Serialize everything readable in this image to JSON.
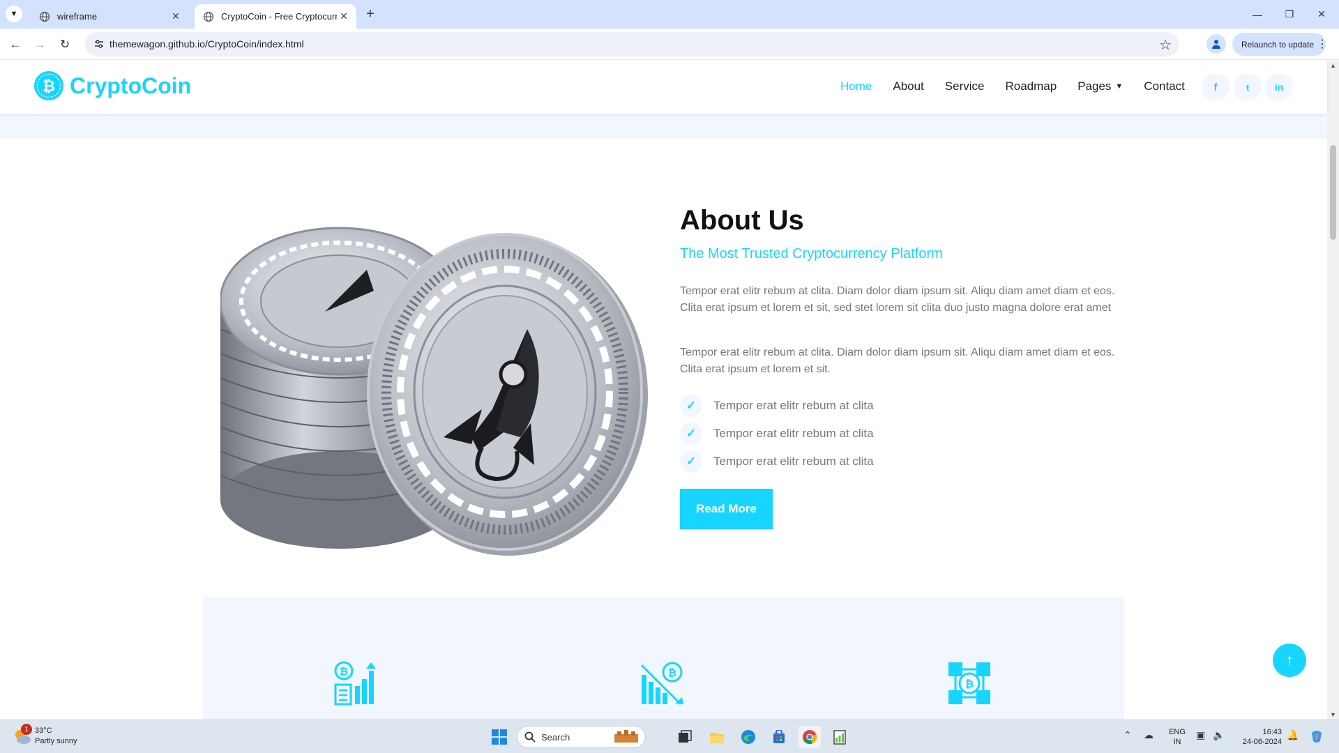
{
  "browser": {
    "tabs": [
      {
        "title": "wireframe",
        "active": false
      },
      {
        "title": "CryptoCoin - Free Cryptocurren",
        "active": true
      }
    ],
    "new_tab": "+",
    "url": "themewagon.github.io/CryptoCoin/index.html",
    "relaunch_label": "Relaunch to update"
  },
  "site": {
    "brand": "CryptoCoin",
    "nav": [
      {
        "label": "Home",
        "active": true
      },
      {
        "label": "About",
        "active": false
      },
      {
        "label": "Service",
        "active": false
      },
      {
        "label": "Roadmap",
        "active": false
      },
      {
        "label": "Pages",
        "active": false,
        "dropdown": true
      },
      {
        "label": "Contact",
        "active": false
      }
    ],
    "social": [
      "facebook-icon",
      "twitter-icon",
      "linkedin-icon"
    ],
    "social_glyphs": {
      "facebook": "f",
      "twitter": "t",
      "linkedin": "in"
    }
  },
  "about": {
    "title": "About Us",
    "subtitle": "The Most Trusted Cryptocurrency Platform",
    "paragraph1": "Tempor erat elitr rebum at clita. Diam dolor diam ipsum sit. Aliqu diam amet diam et eos. Clita erat ipsum et lorem et sit, sed stet lorem sit clita duo justo magna dolore erat amet",
    "paragraph2": "Tempor erat elitr rebum at clita. Diam dolor diam ipsum sit. Aliqu diam amet diam et eos. Clita erat ipsum et lorem et sit.",
    "checklist": [
      "Tempor erat elitr rebum at clita",
      "Tempor erat elitr rebum at clita",
      "Tempor erat elitr rebum at clita"
    ],
    "button": "Read More"
  },
  "features": {
    "icons": [
      "bitcoin-growth-chart-icon",
      "bitcoin-decline-chart-icon",
      "bitcoin-network-icon"
    ]
  },
  "colors": {
    "accent": "#16d5ff",
    "light_bg": "#f2f7ff",
    "text_muted": "#777777"
  },
  "taskbar": {
    "weather_temp": "33°C",
    "weather_desc": "Partly sunny",
    "weather_badge": "1",
    "search": "Search",
    "lang_line1": "ENG",
    "lang_line2": "IN",
    "time": "16:43",
    "date": "24-06-2024"
  }
}
